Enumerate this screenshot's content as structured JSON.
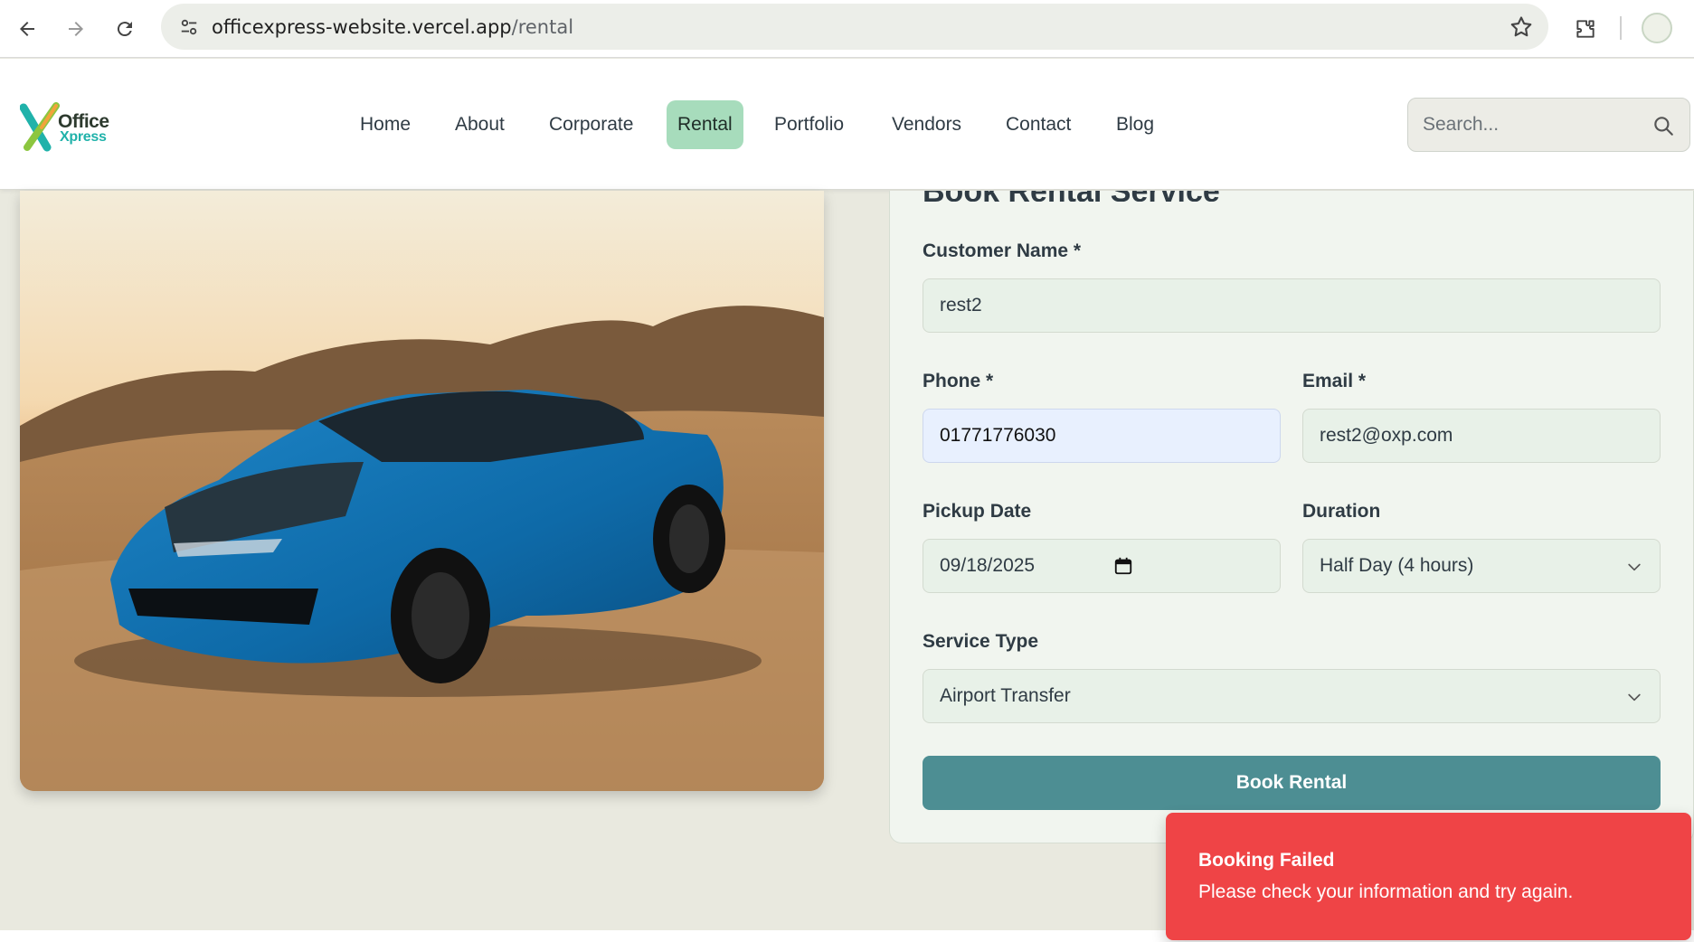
{
  "browser": {
    "url_host": "officexpress-website.vercel.app",
    "url_path": "/rental"
  },
  "logo": {
    "line1": "Office",
    "line2": "Xpress"
  },
  "nav": {
    "items": [
      {
        "label": "Home",
        "active": false
      },
      {
        "label": "About",
        "active": false
      },
      {
        "label": "Corporate",
        "active": false
      },
      {
        "label": "Rental",
        "active": true
      },
      {
        "label": "Portfolio",
        "active": false
      },
      {
        "label": "Vendors",
        "active": false
      },
      {
        "label": "Contact",
        "active": false
      },
      {
        "label": "Blog",
        "active": false
      }
    ]
  },
  "search": {
    "placeholder": "Search..."
  },
  "form": {
    "heading": "Book Rental Service",
    "customer_name_label": "Customer Name *",
    "customer_name_value": "rest2",
    "phone_label": "Phone *",
    "phone_value": "01771776030",
    "email_label": "Email *",
    "email_value": "rest2@oxp.com",
    "pickup_date_label": "Pickup Date",
    "pickup_date_value": "09/18/2025",
    "duration_label": "Duration",
    "duration_value": "Half Day (4 hours)",
    "service_type_label": "Service Type",
    "service_type_value": "Airport Transfer",
    "submit_label": "Book Rental"
  },
  "toast": {
    "title": "Booking Failed",
    "message": "Please check your information and try again."
  },
  "colors": {
    "accent": "#4d8e93",
    "nav_active": "#a7dcbc",
    "toast_bg": "#ef4446",
    "page_bg": "#e9e9df"
  }
}
